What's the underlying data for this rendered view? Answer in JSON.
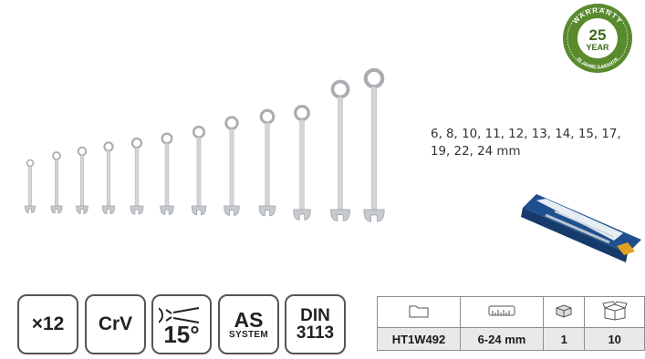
{
  "sizes_text": "6, 8, 10, 11, 12, 13, 14, 15, 17, 19, 22, 24 mm",
  "warranty": {
    "ring_text": "WARRANTY",
    "number": "25",
    "unit": "YEAR",
    "sub_text": "25 JAHRE GARANTIE",
    "color": "#5a8a2e"
  },
  "features": {
    "count": "×12",
    "material": "CrV",
    "angle": "15°",
    "as_big": "AS",
    "as_small": "SYSTEM",
    "din_top": "DIN",
    "din_bottom": "3113"
  },
  "spec_table": {
    "icons": [
      "folder-icon",
      "ruler-icon",
      "single-box-icon",
      "carton-icon"
    ],
    "values": [
      "HT1W492",
      "6-24 mm",
      "1",
      "10"
    ]
  }
}
